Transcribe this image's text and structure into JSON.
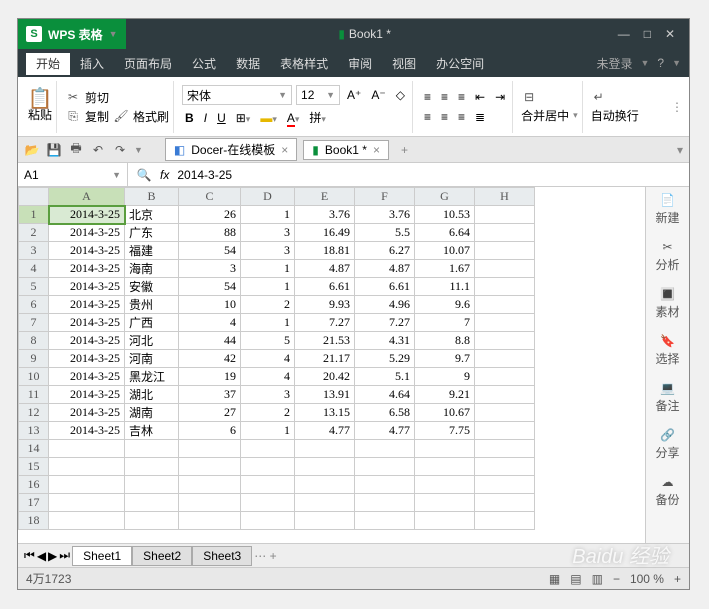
{
  "app": {
    "name": "WPS 表格",
    "doc_title": "Book1 *"
  },
  "menus": [
    "开始",
    "插入",
    "页面布局",
    "公式",
    "数据",
    "表格样式",
    "审阅",
    "视图",
    "办公空间"
  ],
  "menu_right": {
    "login": "未登录"
  },
  "ribbon": {
    "paste": "粘贴",
    "cut": "剪切",
    "copy": "复制",
    "format_painter": "格式刷",
    "font": "宋体",
    "size": "12",
    "merge": "合并居中",
    "wrap": "自动换行"
  },
  "qat_tabs": {
    "docer": "Docer-在线模板",
    "book": "Book1 *"
  },
  "namebox": "A1",
  "formula": "2014-3-25",
  "columns": [
    "A",
    "B",
    "C",
    "D",
    "E",
    "F",
    "G",
    "H"
  ],
  "row_count": 18,
  "rows": [
    {
      "a": "2014-3-25",
      "b": "北京",
      "c": "26",
      "d": "1",
      "e": "3.76",
      "f": "3.76",
      "g": "10.53"
    },
    {
      "a": "2014-3-25",
      "b": "广东",
      "c": "88",
      "d": "3",
      "e": "16.49",
      "f": "5.5",
      "g": "6.64"
    },
    {
      "a": "2014-3-25",
      "b": "福建",
      "c": "54",
      "d": "3",
      "e": "18.81",
      "f": "6.27",
      "g": "10.07"
    },
    {
      "a": "2014-3-25",
      "b": "海南",
      "c": "3",
      "d": "1",
      "e": "4.87",
      "f": "4.87",
      "g": "1.67"
    },
    {
      "a": "2014-3-25",
      "b": "安徽",
      "c": "54",
      "d": "1",
      "e": "6.61",
      "f": "6.61",
      "g": "11.1"
    },
    {
      "a": "2014-3-25",
      "b": "贵州",
      "c": "10",
      "d": "2",
      "e": "9.93",
      "f": "4.96",
      "g": "9.6"
    },
    {
      "a": "2014-3-25",
      "b": "广西",
      "c": "4",
      "d": "1",
      "e": "7.27",
      "f": "7.27",
      "g": "7"
    },
    {
      "a": "2014-3-25",
      "b": "河北",
      "c": "44",
      "d": "5",
      "e": "21.53",
      "f": "4.31",
      "g": "8.8"
    },
    {
      "a": "2014-3-25",
      "b": "河南",
      "c": "42",
      "d": "4",
      "e": "21.17",
      "f": "5.29",
      "g": "9.7"
    },
    {
      "a": "2014-3-25",
      "b": "黑龙江",
      "c": "19",
      "d": "4",
      "e": "20.42",
      "f": "5.1",
      "g": "9"
    },
    {
      "a": "2014-3-25",
      "b": "湖北",
      "c": "37",
      "d": "3",
      "e": "13.91",
      "f": "4.64",
      "g": "9.21"
    },
    {
      "a": "2014-3-25",
      "b": "湖南",
      "c": "27",
      "d": "2",
      "e": "13.15",
      "f": "6.58",
      "g": "10.67"
    },
    {
      "a": "2014-3-25",
      "b": "吉林",
      "c": "6",
      "d": "1",
      "e": "4.77",
      "f": "4.77",
      "g": "7.75"
    }
  ],
  "sheets": [
    "Sheet1",
    "Sheet2",
    "Sheet3"
  ],
  "status": {
    "info": "4万1723",
    "zoom": "100 %"
  },
  "sidebar": [
    {
      "icon": "📄",
      "label": "新建"
    },
    {
      "icon": "✂",
      "label": "分析"
    },
    {
      "icon": "🔳",
      "label": "素材"
    },
    {
      "icon": "🔖",
      "label": "选择"
    },
    {
      "icon": "💻",
      "label": "备注"
    },
    {
      "icon": "🔗",
      "label": "分享"
    },
    {
      "icon": "☁",
      "label": "备份"
    }
  ],
  "watermark": "Baidu 经验"
}
